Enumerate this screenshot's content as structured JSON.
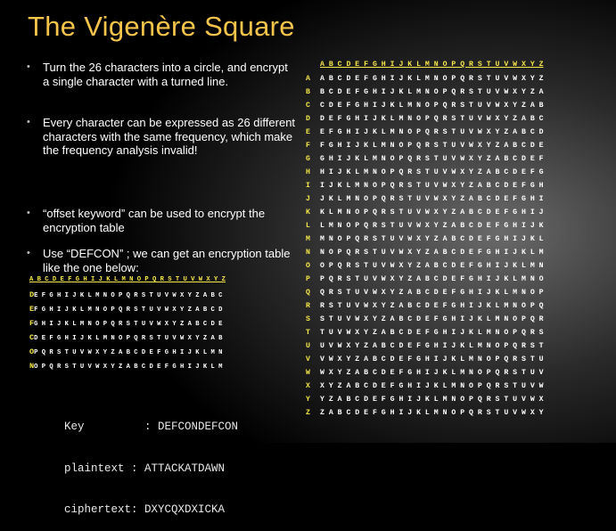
{
  "title": "The Vigenère Square",
  "bullets": [
    "Turn the 26 characters into a circle, and encrypt a single character with a turned line.",
    "Every character can be expressed as 26 different characters with the same frequency, which make the frequency analysis invalid!",
    "“offset keyword” can be used to encrypt the encryption table",
    "Use  “DEFCON” ; we can get an encryption table like the one below:"
  ],
  "small_table": {
    "header": "A B C D E F G H I J K L M N O P Q R S T U V W X Y Z",
    "rows": [
      {
        "lead": "D",
        "text": "E F G H I J K L M N O P Q R S T U V W X Y Z A B C"
      },
      {
        "lead": "E",
        "text": "F G H I J K L M N O P Q R S T U V W X Y Z A B C D"
      },
      {
        "lead": "F",
        "text": "G H I J K L M N O P Q R S T U V W X Y Z A B C D E"
      },
      {
        "lead": "C",
        "text": "D E F G H I J K L M N O P Q R S T U V W X Y Z A B"
      },
      {
        "lead": "O",
        "text": "P Q R S T U V W X Y Z A B C D E F G H I J K L M N"
      },
      {
        "lead": "N",
        "text": "O P Q R S T U V W X Y Z A B C D E F G H I J K L M"
      }
    ]
  },
  "big_table": {
    "header": "A B C D E F G H I J K L M N O P Q R S T U V W X Y Z",
    "rows": [
      {
        "lead": "A",
        "text": "A B C D E F G H I J K L M N O P Q R S T U V W X Y Z"
      },
      {
        "lead": "B",
        "text": "B C D E F G H I J K L M N O P Q R S T U V W X Y Z A"
      },
      {
        "lead": "C",
        "text": "C D E F G H I J K L M N O P Q R S T U V W X Y Z A B"
      },
      {
        "lead": "D",
        "text": "D E F G H I J K L M N O P Q R S T U V W X Y Z A B C"
      },
      {
        "lead": "E",
        "text": "E F G H I J K L M N O P Q R S T U V W X Y Z A B C D"
      },
      {
        "lead": "F",
        "text": "F G H I J K L M N O P Q R S T U V W X Y Z A B C D E"
      },
      {
        "lead": "G",
        "text": "G H I J K L M N O P Q R S T U V W X Y Z A B C D E F"
      },
      {
        "lead": "H",
        "text": "H I J K L M N O P Q R S T U V W X Y Z A B C D E F G"
      },
      {
        "lead": "I",
        "text": "I J K L M N O P Q R S T U V W X Y Z A B C D E F G H"
      },
      {
        "lead": "J",
        "text": "J K L M N O P Q R S T U V W X Y Z A B C D E F G H I"
      },
      {
        "lead": "K",
        "text": "K L M N O P Q R S T U V W X Y Z A B C D E F G H I J"
      },
      {
        "lead": "L",
        "text": "L M N O P Q R S T U V W X Y Z A B C D E F G H I J K"
      },
      {
        "lead": "M",
        "text": "M N O P Q R S T U V W X Y Z A B C D E F G H I J K L"
      },
      {
        "lead": "N",
        "text": "N O P Q R S T U V W X Y Z A B C D E F G H I J K L M"
      },
      {
        "lead": "O",
        "text": "O P Q R S T U V W X Y Z A B C D E F G H I J K L M N"
      },
      {
        "lead": "P",
        "text": "P Q R S T U V W X Y Z A B C D E F G H I J K L M N O"
      },
      {
        "lead": "Q",
        "text": "Q R S T U V W X Y Z A B C D E F G H I J K L M N O P"
      },
      {
        "lead": "R",
        "text": "R S T U V W X Y Z A B C D E F G H I J K L M N O P Q"
      },
      {
        "lead": "S",
        "text": "S T U V W X Y Z A B C D E F G H I J K L M N O P Q R"
      },
      {
        "lead": "T",
        "text": "T U V W X Y Z A B C D E F G H I J K L M N O P Q R S"
      },
      {
        "lead": "U",
        "text": "U V W X Y Z A B C D E F G H I J K L M N O P Q R S T"
      },
      {
        "lead": "V",
        "text": "V W X Y Z A B C D E F G H I J K L M N O P Q R S T U"
      },
      {
        "lead": "W",
        "text": "W X Y Z A B C D E F G H I J K L M N O P Q R S T U V"
      },
      {
        "lead": "X",
        "text": "X Y Z A B C D E F G H I J K L M N O P Q R S T U V W"
      },
      {
        "lead": "Y",
        "text": "Y Z A B C D E F G H I J K L M N O P Q R S T U V W X"
      },
      {
        "lead": "Z",
        "text": "Z A B C D E F G H I J K L M N O P Q R S T U V W X Y"
      }
    ]
  },
  "key_block": {
    "key_label": "Key         :",
    "key_value": "DEFCONDEFCON",
    "plain_label": "plaintext :",
    "plain_value": "ATTACKATDAWN",
    "cipher_label": "ciphertext:",
    "cipher_value": "DXYCQXDXICKA"
  },
  "colors": {
    "title": "#f5c44a",
    "accent_letters": "#f5e84a",
    "text": "#ffffff"
  }
}
